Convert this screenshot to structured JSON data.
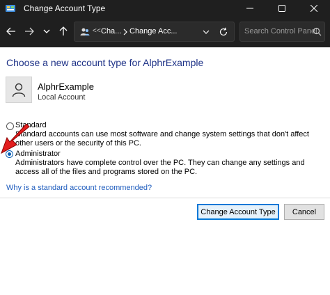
{
  "window": {
    "title": "Change Account Type",
    "icon": "control-panel-icon"
  },
  "nav": {
    "address": {
      "overflow": "<<",
      "crumbs": [
        "Cha...",
        "Change Acc..."
      ]
    },
    "search_placeholder": "Search Control Panel"
  },
  "content": {
    "heading": "Choose a new account type for AlphrExample",
    "user": {
      "name": "AlphrExample",
      "account_type": "Local Account"
    },
    "options": [
      {
        "label": "Standard",
        "description": "Standard accounts can use most software and change system settings that don't affect other users or the security of this PC.",
        "selected": false
      },
      {
        "label": "Administrator",
        "description": "Administrators have complete control over the PC. They can change any settings and access all of the files and programs stored on the PC.",
        "selected": true
      }
    ],
    "help_link": "Why is a standard account recommended?"
  },
  "buttons": {
    "primary": "Change Account Type",
    "cancel": "Cancel"
  },
  "colors": {
    "titlebar": "#1f1f1f",
    "heading": "#1e3287",
    "link": "#1f5dbe",
    "accent": "#0078d7",
    "arrow": "#e21d1d"
  }
}
